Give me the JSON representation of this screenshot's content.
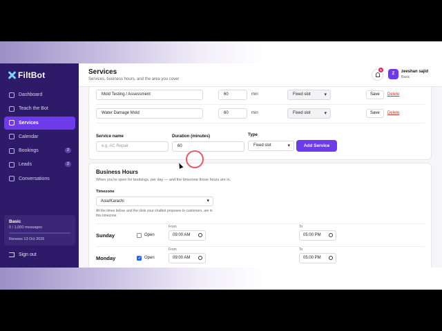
{
  "brand": {
    "name": "FiltBot"
  },
  "sidebar": {
    "items": [
      {
        "label": "Dashboard",
        "badge": ""
      },
      {
        "label": "Teach the Bot",
        "badge": ""
      },
      {
        "label": "Services",
        "badge": "",
        "active": true
      },
      {
        "label": "Calendar",
        "badge": ""
      },
      {
        "label": "Bookings",
        "badge": "2"
      },
      {
        "label": "Leads",
        "badge": "2"
      },
      {
        "label": "Conversations",
        "badge": ""
      }
    ],
    "plan": {
      "name": "Basic",
      "usage": "0 / 1,000 messages",
      "renews": "Renews 13 Oct 2026"
    },
    "signout": "Sign out"
  },
  "header": {
    "title": "Services",
    "subtitle": "Services, business hours, and the area you cover",
    "notification_count": "5",
    "user": {
      "initial": "Z",
      "name": "zeeshan sajid",
      "plan": "Basic"
    }
  },
  "services": {
    "rows": [
      {
        "name": "Mold Testing / Assessment",
        "duration": "60",
        "unit": "min",
        "type": "Fixed slot",
        "save": "Save",
        "delete": "Delete"
      },
      {
        "name": "Water Damage Mold",
        "duration": "60",
        "unit": "min",
        "type": "Fixed slot",
        "save": "Save",
        "delete": "Delete"
      }
    ],
    "new": {
      "name_label": "Service name",
      "name_placeholder": "e.g. AC Repair",
      "duration_label": "Duration (minutes)",
      "duration_value": "60",
      "type_label": "Type",
      "type_value": "Fixed slot",
      "add_label": "Add Service"
    }
  },
  "hours": {
    "title": "Business Hours",
    "description": "When you're open for bookings, per day — and the timezone those hours are in.",
    "timezone_label": "Timezone",
    "timezone_value": "Asia/Karachi",
    "timezone_note": "All the times below, and the slots your chatbot proposes to customers, are in this timezone.",
    "days": [
      {
        "name": "Sunday",
        "open": false,
        "open_label": "Open",
        "from_label": "From",
        "from": "09:00 AM",
        "to_label": "To",
        "to": "05:00 PM"
      },
      {
        "name": "Monday",
        "open": true,
        "open_label": "Open",
        "from_label": "From",
        "from": "09:00 AM",
        "to_label": "To",
        "to": "05:00 PM"
      }
    ]
  }
}
